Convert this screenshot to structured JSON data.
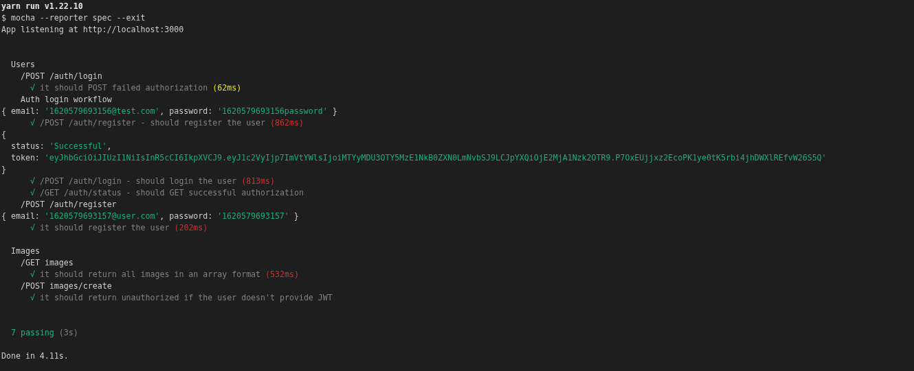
{
  "terminal": {
    "lines": [
      {
        "kind": "header",
        "text": "yarn run v1.22.10"
      },
      {
        "kind": "output",
        "text": "$ mocha --reporter spec --exit"
      },
      {
        "kind": "output",
        "text": "App listening at http://localhost:3000"
      },
      {
        "kind": "blank"
      },
      {
        "kind": "blank"
      },
      {
        "kind": "suite",
        "text": "Users"
      },
      {
        "kind": "group",
        "text": "/POST /auth/login"
      },
      {
        "kind": "test",
        "mark": "√",
        "title": "it should POST failed authorization",
        "duration": "(62ms)",
        "color": "#e5e510"
      },
      {
        "kind": "group",
        "text": "Auth login workflow"
      },
      {
        "kind": "log",
        "parts": [
          {
            "t": "{ email: ",
            "string": false
          },
          {
            "t": "'1620579693156@test.com'",
            "string": true
          },
          {
            "t": ", password: ",
            "string": false
          },
          {
            "t": "'1620579693156password'",
            "string": true
          },
          {
            "t": " }",
            "string": false
          }
        ]
      },
      {
        "kind": "test",
        "mark": "√",
        "title": "/POST /auth/register - should register the user",
        "duration": "(862ms)",
        "color": "#cd3131"
      },
      {
        "kind": "log",
        "parts": [
          {
            "t": "{",
            "string": false
          }
        ]
      },
      {
        "kind": "log",
        "parts": [
          {
            "t": "  status: ",
            "string": false
          },
          {
            "t": "'Successful'",
            "string": true
          },
          {
            "t": ",",
            "string": false
          }
        ]
      },
      {
        "kind": "log",
        "parts": [
          {
            "t": "  token: ",
            "string": false
          },
          {
            "t": "'eyJhbGciOiJIUzI1NiIsInR5cCI6IkpXVCJ9.eyJ1c2VyIjp7ImVtYWlsIjoiMTYyMDU3OTY5MzE1NkB0ZXN0LmNvbSJ9LCJpYXQiOjE2MjA1Nzk2OTR9.P7OxEUjjxz2EcoPK1ye0tK5rbi4jhDWXlREfvW26S5Q'",
            "string": true
          }
        ]
      },
      {
        "kind": "log",
        "parts": [
          {
            "t": "}",
            "string": false
          }
        ]
      },
      {
        "kind": "test",
        "mark": "√",
        "title": "/POST /auth/login - should login the user",
        "duration": "(813ms)",
        "color": "#cd3131"
      },
      {
        "kind": "test",
        "mark": "√",
        "title": "/GET /auth/status - should GET successful authorization"
      },
      {
        "kind": "group",
        "text": "/POST /auth/register"
      },
      {
        "kind": "log",
        "parts": [
          {
            "t": "{ email: ",
            "string": false
          },
          {
            "t": "'1620579693157@user.com'",
            "string": true
          },
          {
            "t": ", password: ",
            "string": false
          },
          {
            "t": "'1620579693157'",
            "string": true
          },
          {
            "t": " }",
            "string": false
          }
        ]
      },
      {
        "kind": "test",
        "mark": "√",
        "title": "it should register the user",
        "duration": "(202ms)",
        "color": "#cd3131"
      },
      {
        "kind": "blank"
      },
      {
        "kind": "suite",
        "text": "Images"
      },
      {
        "kind": "group",
        "text": "/GET images"
      },
      {
        "kind": "test",
        "mark": "√",
        "title": "it should return all images in an array format",
        "duration": "(532ms)",
        "color": "#cd3131"
      },
      {
        "kind": "group",
        "text": "/POST images/create"
      },
      {
        "kind": "test",
        "mark": "√",
        "title": "it should return unauthorized if the user doesn't provide JWT"
      },
      {
        "kind": "blank"
      },
      {
        "kind": "blank"
      },
      {
        "kind": "summary",
        "count": "7 passing",
        "time": "(3s)"
      },
      {
        "kind": "blank"
      },
      {
        "kind": "output",
        "text": "Done in 4.11s."
      }
    ]
  }
}
